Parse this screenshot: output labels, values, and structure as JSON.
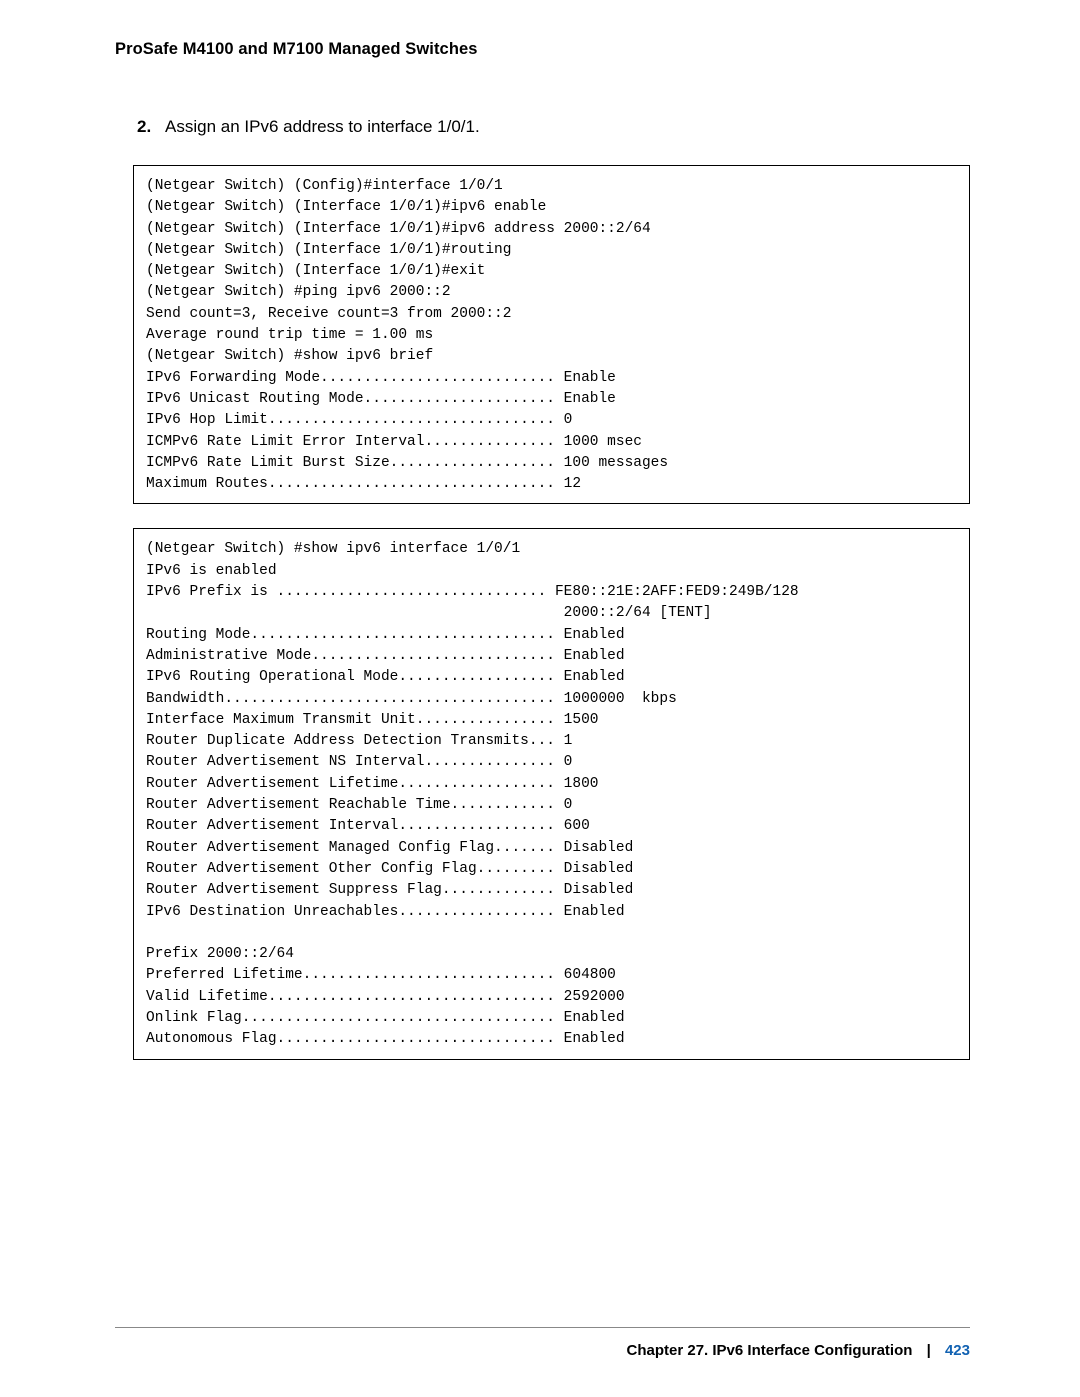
{
  "header": {
    "title": "ProSafe M4100 and M7100 Managed Switches"
  },
  "step": {
    "number": "2.",
    "text": "Assign an IPv6 address to interface 1/0/1."
  },
  "code1": "(Netgear Switch) (Config)#interface 1/0/1\n(Netgear Switch) (Interface 1/0/1)#ipv6 enable\n(Netgear Switch) (Interface 1/0/1)#ipv6 address 2000::2/64\n(Netgear Switch) (Interface 1/0/1)#routing\n(Netgear Switch) (Interface 1/0/1)#exit\n(Netgear Switch) #ping ipv6 2000::2\nSend count=3, Receive count=3 from 2000::2\nAverage round trip time = 1.00 ms\n(Netgear Switch) #show ipv6 brief\nIPv6 Forwarding Mode........................... Enable\nIPv6 Unicast Routing Mode...................... Enable\nIPv6 Hop Limit................................. 0\nICMPv6 Rate Limit Error Interval............... 1000 msec\nICMPv6 Rate Limit Burst Size................... 100 messages\nMaximum Routes................................. 12",
  "code2": "(Netgear Switch) #show ipv6 interface 1/0/1\nIPv6 is enabled\nIPv6 Prefix is ............................... FE80::21E:2AFF:FED9:249B/128\n                                                2000::2/64 [TENT]\nRouting Mode................................... Enabled\nAdministrative Mode............................ Enabled\nIPv6 Routing Operational Mode.................. Enabled\nBandwidth...................................... 1000000  kbps\nInterface Maximum Transmit Unit................ 1500\nRouter Duplicate Address Detection Transmits... 1\nRouter Advertisement NS Interval............... 0\nRouter Advertisement Lifetime.................. 1800\nRouter Advertisement Reachable Time............ 0\nRouter Advertisement Interval.................. 600\nRouter Advertisement Managed Config Flag....... Disabled\nRouter Advertisement Other Config Flag......... Disabled\nRouter Advertisement Suppress Flag............. Disabled\nIPv6 Destination Unreachables.................. Enabled\n\nPrefix 2000::2/64\nPreferred Lifetime............................. 604800\nValid Lifetime................................. 2592000\nOnlink Flag.................................... Enabled\nAutonomous Flag................................ Enabled",
  "footer": {
    "chapter": "Chapter 27.  IPv6 Interface Configuration",
    "separator": "|",
    "page": "423"
  }
}
